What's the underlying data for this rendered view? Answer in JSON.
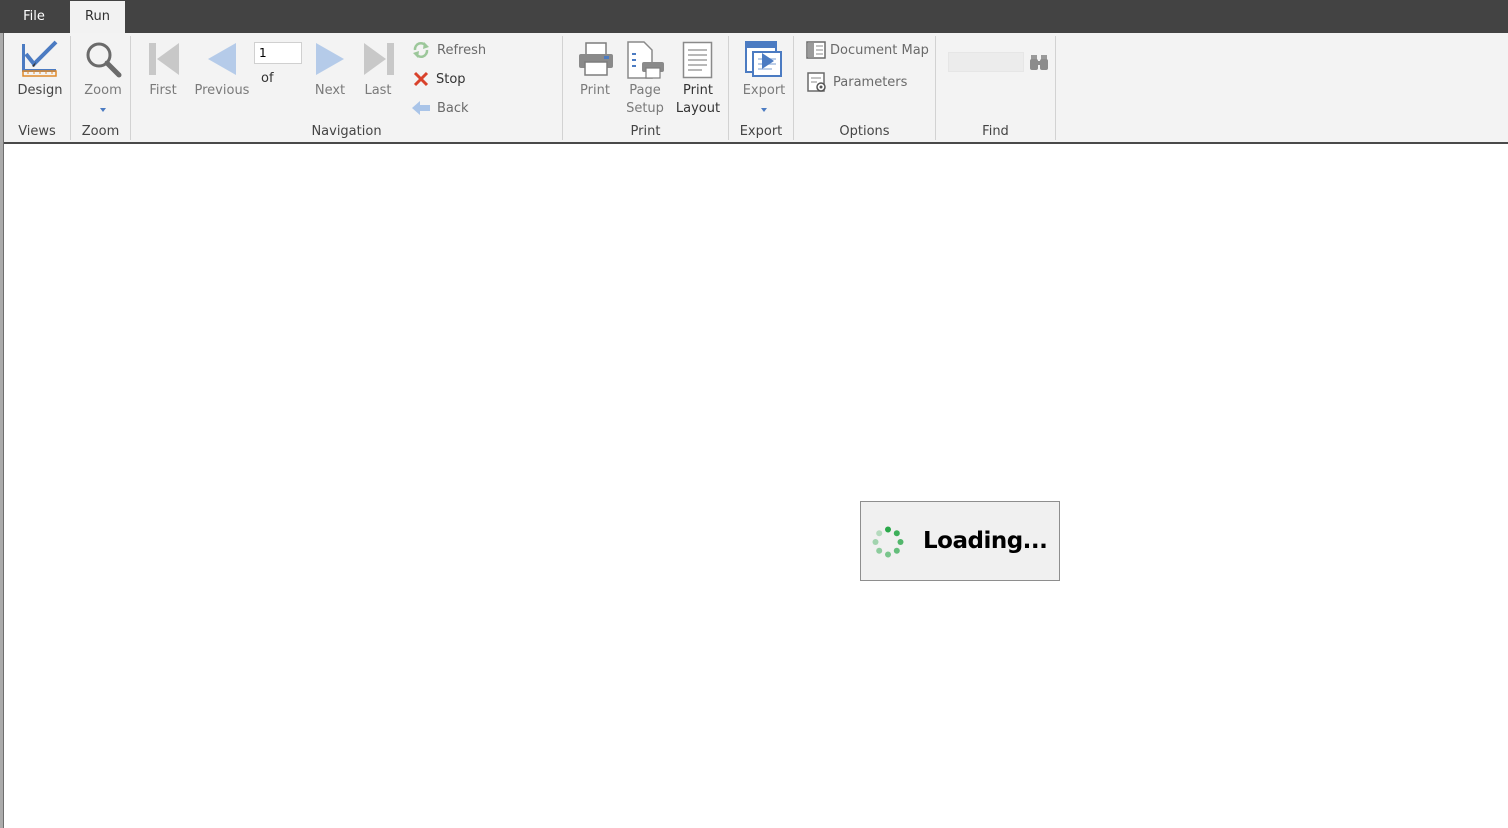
{
  "menu": {
    "tabs": [
      {
        "label": "File"
      },
      {
        "label": "Run"
      }
    ],
    "active": "Run"
  },
  "ribbon": {
    "groups": {
      "views": "Views",
      "zoom": "Zoom",
      "navigation": "Navigation",
      "print": "Print",
      "export": "Export",
      "options": "Options",
      "find": "Find"
    },
    "buttons": {
      "design": "Design",
      "zoom": "Zoom",
      "first": "First",
      "previous": "Previous",
      "next": "Next",
      "last": "Last",
      "refresh": "Refresh",
      "stop": "Stop",
      "back": "Back",
      "print": "Print",
      "page_setup_1": "Page",
      "page_setup_2": "Setup",
      "print_layout_1": "Print",
      "print_layout_2": "Layout",
      "export": "Export",
      "document_map": "Document Map",
      "parameters": "Parameters"
    },
    "page_number": "1",
    "of_label": "of",
    "find_value": ""
  },
  "loading": {
    "text": "Loading..."
  },
  "colors": {
    "menubar": "#434343",
    "ribbon": "#f3f3f3",
    "accent_blue": "#4b7bc2",
    "stop_red": "#d9422b",
    "spinner_green": "#2aa84a"
  }
}
